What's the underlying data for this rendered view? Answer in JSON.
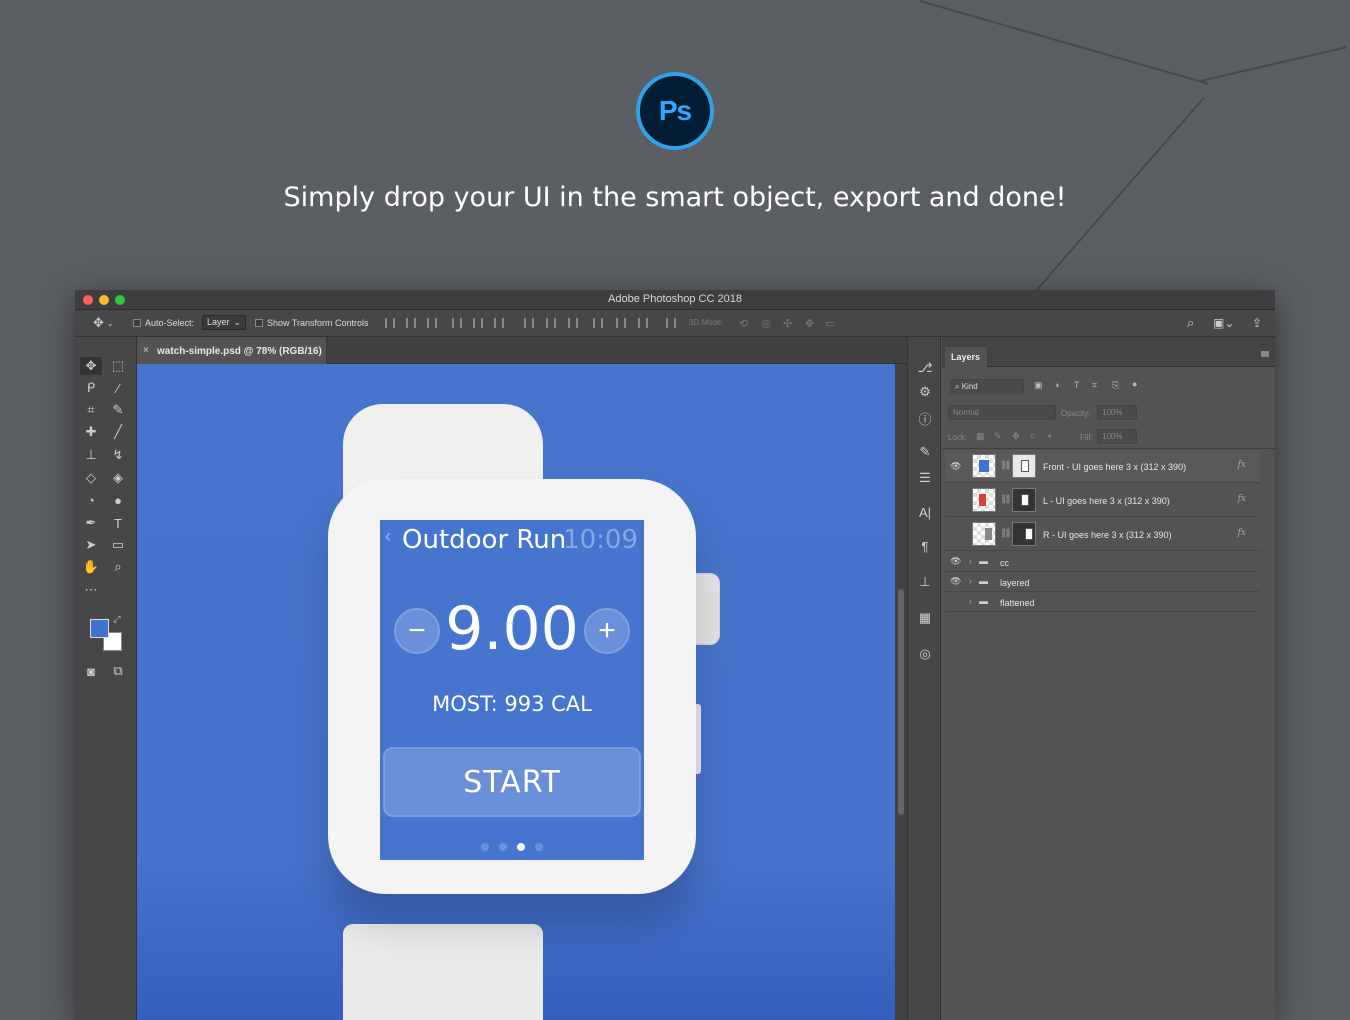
{
  "hero": {
    "logo_text": "Ps",
    "headline": "Simply drop your UI in the smart object, export and done!"
  },
  "window": {
    "title": "Adobe Photoshop CC 2018"
  },
  "options_bar": {
    "auto_select_label": "Auto-Select:",
    "auto_select_value": "Layer",
    "show_transform_label": "Show Transform Controls",
    "mode_3d_label": "3D Mode:"
  },
  "document": {
    "tab_label": "watch-simple.psd @ 78% (RGB/16)",
    "tab_close": "×"
  },
  "watch_screen": {
    "back_glyph": "‹",
    "title": "Outdoor Run",
    "time": "10:09",
    "minus": "−",
    "value": "9.00",
    "plus": "+",
    "most": "MOST: 993 CAL",
    "start": "START"
  },
  "layers_panel": {
    "tab": "Layers",
    "filter_kind": "Kind",
    "blend_mode": "Normal",
    "opacity_label": "Opacity:",
    "opacity_value": "100%",
    "lock_label": "Lock:",
    "fill_label": "Fill:",
    "fill_value": "100%",
    "layers": [
      {
        "name": "Front - UI goes here 3 x (312 x 390)",
        "fx": "fx",
        "visible": true,
        "color": "#3f73d0"
      },
      {
        "name": "L - UI goes here 3 x (312 x 390)",
        "fx": "fx",
        "visible": false,
        "color": "#d64040"
      },
      {
        "name": "R - UI goes here 3 x (312 x 390)",
        "fx": "fx",
        "visible": false,
        "color": "#888888"
      }
    ],
    "groups": [
      {
        "name": "cc",
        "visible": true
      },
      {
        "name": "layered",
        "visible": true
      },
      {
        "name": "flattened",
        "visible": false
      }
    ]
  },
  "colors": {
    "foreground": "#3f73d0",
    "background": "#ffffff",
    "canvas_blue": "#4774cc"
  }
}
